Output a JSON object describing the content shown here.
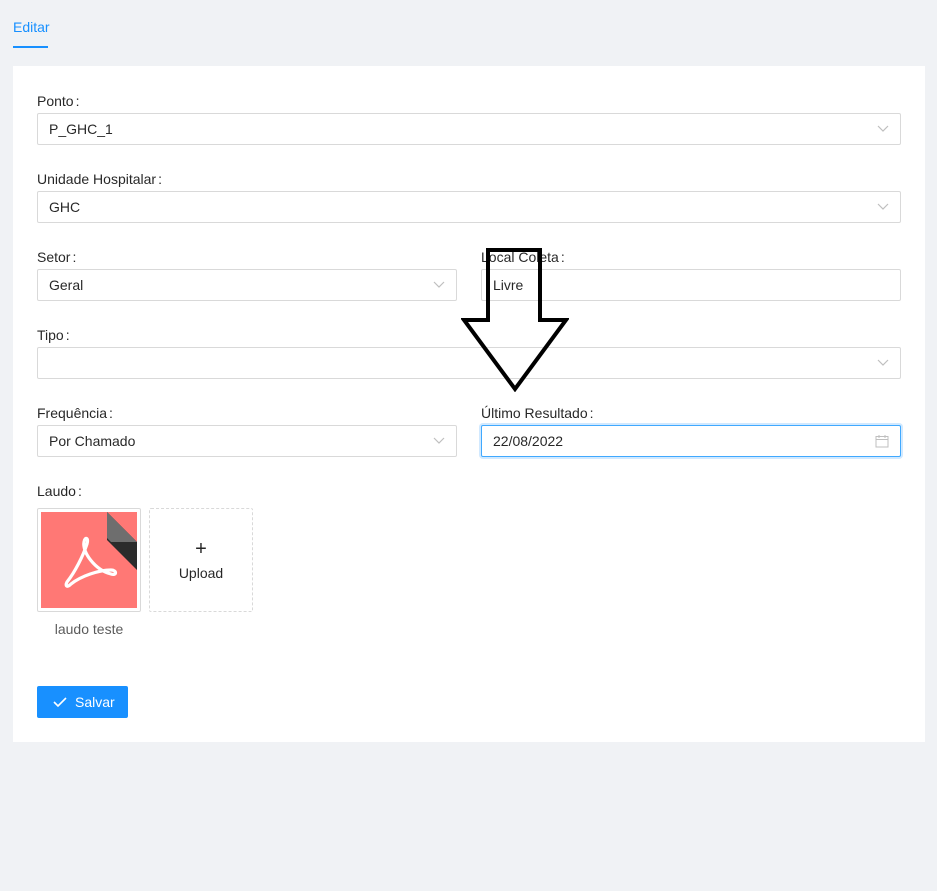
{
  "tabs": {
    "active": "Editar"
  },
  "form": {
    "colon": ":",
    "ponto": {
      "label": "Ponto",
      "value": "P_GHC_1"
    },
    "unidade": {
      "label": "Unidade Hospitalar",
      "value": "GHC"
    },
    "setor": {
      "label": "Setor",
      "value": "Geral"
    },
    "local_coleta": {
      "label": "Local Coleta",
      "value": "Livre"
    },
    "tipo": {
      "label": "Tipo",
      "value": ""
    },
    "frequencia": {
      "label": "Frequência",
      "value": "Por Chamado"
    },
    "ultimo_resultado": {
      "label": "Último Resultado",
      "value": "22/08/2022"
    },
    "laudo": {
      "label": "Laudo",
      "file_name": "laudo teste",
      "upload_plus": "+",
      "upload_label": "Upload"
    }
  },
  "actions": {
    "save_label": "Salvar"
  },
  "colors": {
    "primary": "#1890ff",
    "pdf_bg": "#ff7875",
    "page_bg": "#f0f2f5"
  },
  "icons": [
    "chevron-down-icon",
    "calendar-icon",
    "pdf-icon",
    "plus-icon",
    "check-icon",
    "down-arrow-annotation"
  ]
}
